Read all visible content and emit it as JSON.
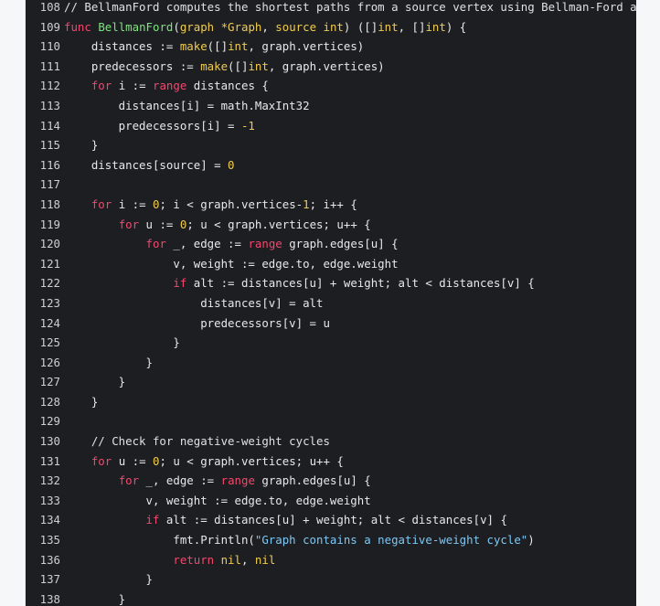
{
  "code_view": {
    "colors": {
      "background": "#1d1e22",
      "keyword": "#f3476d",
      "function": "#7fe37f",
      "number": "#f0cc4e",
      "string": "#7dc8f5",
      "text": "#e8e8e8"
    },
    "lines": [
      {
        "number": "108",
        "tokens": [
          [
            "com",
            "// BellmanFord computes the shortest paths from a source vertex using Bellman-Ford al"
          ]
        ]
      },
      {
        "number": "109",
        "tokens": [
          [
            "kw",
            "func "
          ],
          [
            "fn",
            "BellmanFord"
          ],
          [
            "plain",
            "("
          ],
          [
            "builtin",
            "graph *Graph"
          ],
          [
            "plain",
            ", "
          ],
          [
            "builtin",
            "source int"
          ],
          [
            "plain",
            ") ([]"
          ],
          [
            "builtin",
            "int"
          ],
          [
            "plain",
            ", []"
          ],
          [
            "builtin",
            "int"
          ],
          [
            "plain",
            ") {"
          ]
        ]
      },
      {
        "number": "110",
        "tokens": [
          [
            "plain",
            "    distances := "
          ],
          [
            "builtin",
            "make"
          ],
          [
            "plain",
            "([]"
          ],
          [
            "builtin",
            "int"
          ],
          [
            "plain",
            ", graph.vertices)"
          ]
        ]
      },
      {
        "number": "111",
        "tokens": [
          [
            "plain",
            "    predecessors := "
          ],
          [
            "builtin",
            "make"
          ],
          [
            "plain",
            "([]"
          ],
          [
            "builtin",
            "int"
          ],
          [
            "plain",
            ", graph.vertices)"
          ]
        ]
      },
      {
        "number": "112",
        "tokens": [
          [
            "plain",
            "    "
          ],
          [
            "kw",
            "for"
          ],
          [
            "plain",
            " i := "
          ],
          [
            "kw",
            "range"
          ],
          [
            "plain",
            " distances {"
          ]
        ]
      },
      {
        "number": "113",
        "tokens": [
          [
            "plain",
            "        distances[i] = math.MaxInt32"
          ]
        ]
      },
      {
        "number": "114",
        "tokens": [
          [
            "plain",
            "        predecessors[i] = "
          ],
          [
            "num",
            "-1"
          ]
        ]
      },
      {
        "number": "115",
        "tokens": [
          [
            "plain",
            "    }"
          ]
        ]
      },
      {
        "number": "116",
        "tokens": [
          [
            "plain",
            "    distances[source] = "
          ],
          [
            "num",
            "0"
          ]
        ]
      },
      {
        "number": "117",
        "tokens": [
          [
            "plain",
            ""
          ]
        ]
      },
      {
        "number": "118",
        "tokens": [
          [
            "plain",
            "    "
          ],
          [
            "kw",
            "for"
          ],
          [
            "plain",
            " i := "
          ],
          [
            "num",
            "0"
          ],
          [
            "plain",
            "; i < graph.vertices-"
          ],
          [
            "num",
            "1"
          ],
          [
            "plain",
            "; i++ {"
          ]
        ]
      },
      {
        "number": "119",
        "tokens": [
          [
            "plain",
            "        "
          ],
          [
            "kw",
            "for"
          ],
          [
            "plain",
            " u := "
          ],
          [
            "num",
            "0"
          ],
          [
            "plain",
            "; u < graph.vertices; u++ {"
          ]
        ]
      },
      {
        "number": "120",
        "tokens": [
          [
            "plain",
            "            "
          ],
          [
            "kw",
            "for"
          ],
          [
            "plain",
            " _, edge := "
          ],
          [
            "kw",
            "range"
          ],
          [
            "plain",
            " graph.edges[u] {"
          ]
        ]
      },
      {
        "number": "121",
        "tokens": [
          [
            "plain",
            "                v, weight := edge.to, edge.weight"
          ]
        ]
      },
      {
        "number": "122",
        "tokens": [
          [
            "plain",
            "                "
          ],
          [
            "kw",
            "if"
          ],
          [
            "plain",
            " alt := distances[u] + weight; alt < distances[v] {"
          ]
        ]
      },
      {
        "number": "123",
        "tokens": [
          [
            "plain",
            "                    distances[v] = alt"
          ]
        ]
      },
      {
        "number": "124",
        "tokens": [
          [
            "plain",
            "                    predecessors[v] = u"
          ]
        ]
      },
      {
        "number": "125",
        "tokens": [
          [
            "plain",
            "                }"
          ]
        ]
      },
      {
        "number": "126",
        "tokens": [
          [
            "plain",
            "            }"
          ]
        ]
      },
      {
        "number": "127",
        "tokens": [
          [
            "plain",
            "        }"
          ]
        ]
      },
      {
        "number": "128",
        "tokens": [
          [
            "plain",
            "    }"
          ]
        ]
      },
      {
        "number": "129",
        "tokens": [
          [
            "plain",
            ""
          ]
        ]
      },
      {
        "number": "130",
        "tokens": [
          [
            "com",
            "    // Check for negative-weight cycles"
          ]
        ]
      },
      {
        "number": "131",
        "tokens": [
          [
            "plain",
            "    "
          ],
          [
            "kw",
            "for"
          ],
          [
            "plain",
            " u := "
          ],
          [
            "num",
            "0"
          ],
          [
            "plain",
            "; u < graph.vertices; u++ {"
          ]
        ]
      },
      {
        "number": "132",
        "tokens": [
          [
            "plain",
            "        "
          ],
          [
            "kw",
            "for"
          ],
          [
            "plain",
            " _, edge := "
          ],
          [
            "kw",
            "range"
          ],
          [
            "plain",
            " graph.edges[u] {"
          ]
        ]
      },
      {
        "number": "133",
        "tokens": [
          [
            "plain",
            "            v, weight := edge.to, edge.weight"
          ]
        ]
      },
      {
        "number": "134",
        "tokens": [
          [
            "plain",
            "            "
          ],
          [
            "kw",
            "if"
          ],
          [
            "plain",
            " alt := distances[u] + weight; alt < distances[v] {"
          ]
        ]
      },
      {
        "number": "135",
        "tokens": [
          [
            "plain",
            "                fmt.Println("
          ],
          [
            "str",
            "\"Graph contains a negative-weight cycle\""
          ],
          [
            "plain",
            ")"
          ]
        ]
      },
      {
        "number": "136",
        "tokens": [
          [
            "plain",
            "                "
          ],
          [
            "kw",
            "return"
          ],
          [
            "plain",
            " "
          ],
          [
            "builtin",
            "nil"
          ],
          [
            "plain",
            ", "
          ],
          [
            "builtin",
            "nil"
          ]
        ]
      },
      {
        "number": "137",
        "tokens": [
          [
            "plain",
            "            }"
          ]
        ]
      },
      {
        "number": "138",
        "tokens": [
          [
            "plain",
            "        }"
          ]
        ]
      }
    ]
  }
}
